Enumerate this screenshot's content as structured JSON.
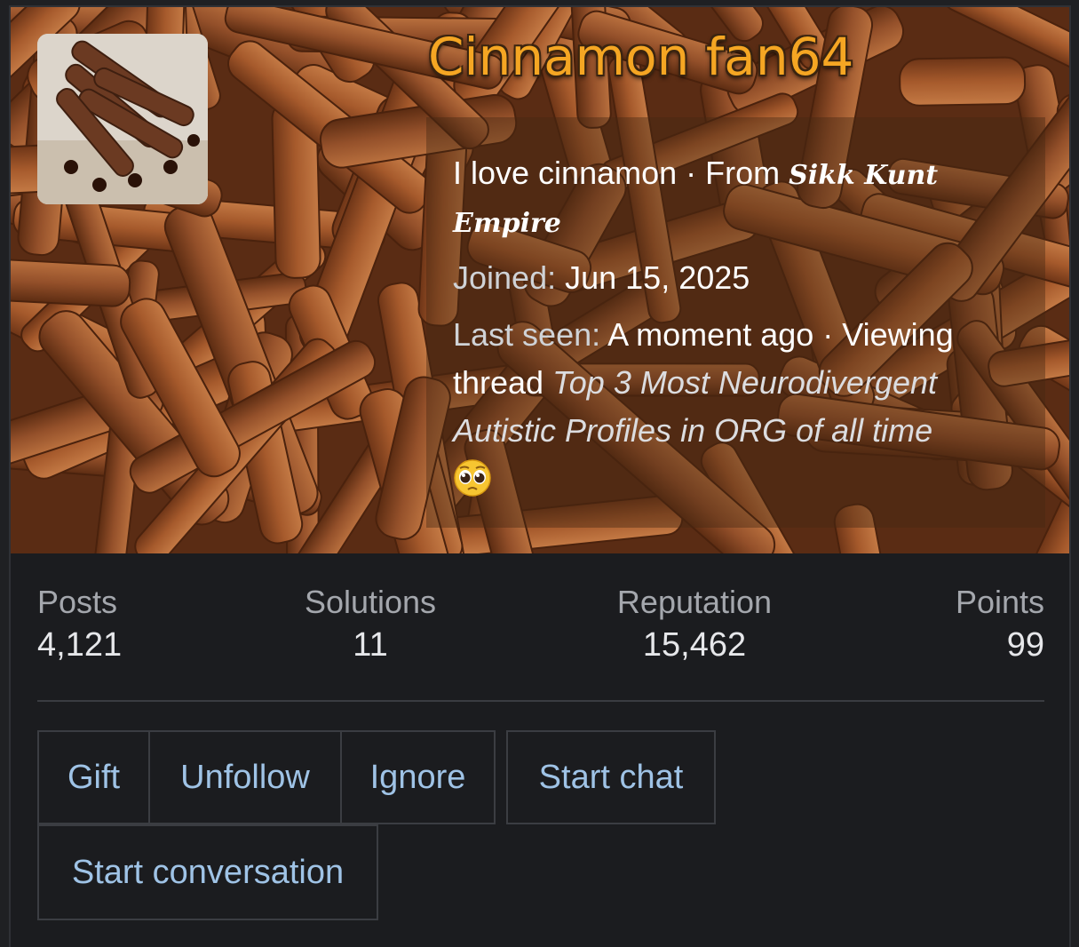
{
  "profile": {
    "username": "Cinnamon fan64",
    "bio": "I love cinnamon",
    "from_sep": " · ",
    "from_label": "From ",
    "location": "Sikk Kunt Empire",
    "joined_label": "Joined:",
    "joined_value": "Jun 15, 2025",
    "last_seen_label": "Last seen:",
    "last_seen_value": "A moment ago",
    "activity_sep": " · ",
    "activity": "Viewing thread",
    "thread_title": "Top 3 Most Neurodivergent Autistic Profiles in ORG of all time",
    "emoji": "pleading-face-emoji"
  },
  "stats": {
    "posts_label": "Posts",
    "posts_value": "4,121",
    "solutions_label": "Solutions",
    "solutions_value": "11",
    "reputation_label": "Reputation",
    "reputation_value": "15,462",
    "points_label": "Points",
    "points_value": "99"
  },
  "actions": {
    "gift": "Gift",
    "unfollow": "Unfollow",
    "ignore": "Ignore",
    "start_chat": "Start chat",
    "start_conversation": "Start conversation"
  },
  "colors": {
    "username": "#f5a623",
    "link": "#9fc3e6",
    "card_bg": "#1b1c1f"
  }
}
